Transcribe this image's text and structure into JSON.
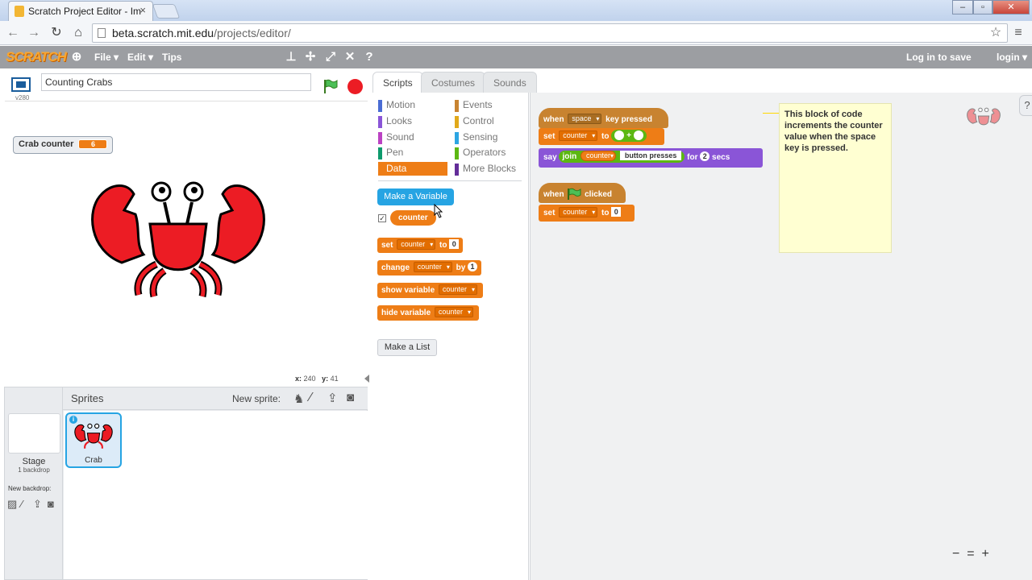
{
  "browser": {
    "tab_title": "Scratch Project Editor - Im",
    "url_host": "beta.scratch.mit.edu",
    "url_path": "/projects/editor/"
  },
  "menubar": {
    "logo": "SCRATCH",
    "file": "File ▾",
    "edit": "Edit ▾",
    "tips": "Tips",
    "login_to_save": "Log in to save",
    "login": "login ▾"
  },
  "stage": {
    "version": "v280",
    "project_title": "Counting Crabs",
    "monitor_label": "Crab counter",
    "monitor_value": "6",
    "coord_x_label": "x:",
    "coord_x": "240",
    "coord_y_label": "y:",
    "coord_y": "41"
  },
  "sprites": {
    "header": "Sprites",
    "new_sprite": "New sprite:",
    "stage_label": "Stage",
    "stage_backdrops": "1 backdrop",
    "new_backdrop": "New backdrop:",
    "items": [
      {
        "name": "Crab"
      }
    ]
  },
  "tabs": [
    {
      "label": "Scripts",
      "active": true
    },
    {
      "label": "Costumes",
      "active": false
    },
    {
      "label": "Sounds",
      "active": false
    }
  ],
  "categories": [
    {
      "label": "Motion",
      "color": "#4a6cd4"
    },
    {
      "label": "Looks",
      "color": "#8a55d7"
    },
    {
      "label": "Sound",
      "color": "#bb42c3"
    },
    {
      "label": "Pen",
      "color": "#0e9a6c"
    },
    {
      "label": "Data",
      "color": "#ee7d16"
    },
    {
      "label": "Events",
      "color": "#c88330"
    },
    {
      "label": "Control",
      "color": "#e1a91a"
    },
    {
      "label": "Sensing",
      "color": "#2ca5e2"
    },
    {
      "label": "Operators",
      "color": "#5cb712"
    },
    {
      "label": "More Blocks",
      "color": "#632d99"
    }
  ],
  "palette": {
    "make_variable": "Make a Variable",
    "variable_name": "counter",
    "blocks": {
      "set": "set",
      "to": "to",
      "set_value": "0",
      "change": "change",
      "by": "by",
      "change_value": "1",
      "show_variable": "show variable",
      "hide_variable": "hide variable"
    },
    "make_list": "Make a List"
  },
  "scripts": {
    "when": "when",
    "space": "space",
    "key_pressed": "key pressed",
    "set": "set",
    "counter": "counter",
    "to": "to",
    "plus": "+",
    "say": "say",
    "join": "join",
    "button_presses": "button presses",
    "for": "for",
    "secs_value": "2",
    "secs": "secs",
    "clicked": "clicked",
    "set_value_0": "0"
  },
  "comment": "This block of code increments the counter value when the space key is pressed.",
  "zoom": {
    "out": "−",
    "reset": "=",
    "in": "+"
  }
}
